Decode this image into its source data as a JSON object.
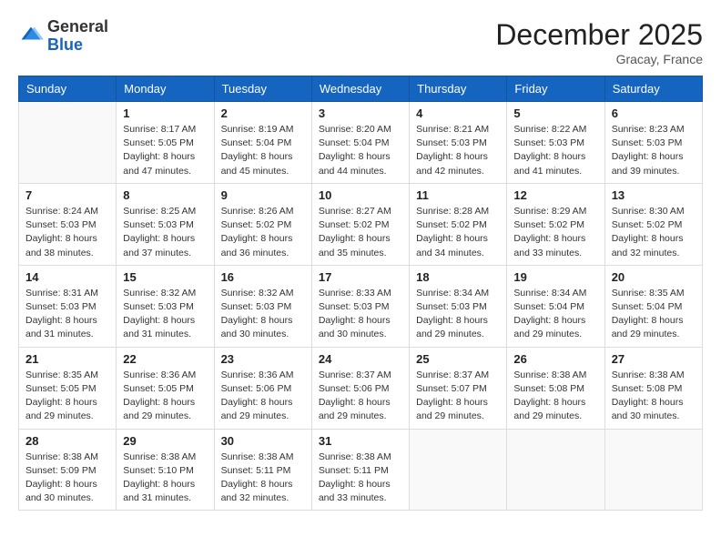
{
  "header": {
    "logo_general": "General",
    "logo_blue": "Blue",
    "month_title": "December 2025",
    "location": "Gracay, France"
  },
  "weekdays": [
    "Sunday",
    "Monday",
    "Tuesday",
    "Wednesday",
    "Thursday",
    "Friday",
    "Saturday"
  ],
  "weeks": [
    [
      {
        "day": "",
        "info": ""
      },
      {
        "day": "1",
        "info": "Sunrise: 8:17 AM\nSunset: 5:05 PM\nDaylight: 8 hours\nand 47 minutes."
      },
      {
        "day": "2",
        "info": "Sunrise: 8:19 AM\nSunset: 5:04 PM\nDaylight: 8 hours\nand 45 minutes."
      },
      {
        "day": "3",
        "info": "Sunrise: 8:20 AM\nSunset: 5:04 PM\nDaylight: 8 hours\nand 44 minutes."
      },
      {
        "day": "4",
        "info": "Sunrise: 8:21 AM\nSunset: 5:03 PM\nDaylight: 8 hours\nand 42 minutes."
      },
      {
        "day": "5",
        "info": "Sunrise: 8:22 AM\nSunset: 5:03 PM\nDaylight: 8 hours\nand 41 minutes."
      },
      {
        "day": "6",
        "info": "Sunrise: 8:23 AM\nSunset: 5:03 PM\nDaylight: 8 hours\nand 39 minutes."
      }
    ],
    [
      {
        "day": "7",
        "info": "Sunrise: 8:24 AM\nSunset: 5:03 PM\nDaylight: 8 hours\nand 38 minutes."
      },
      {
        "day": "8",
        "info": "Sunrise: 8:25 AM\nSunset: 5:03 PM\nDaylight: 8 hours\nand 37 minutes."
      },
      {
        "day": "9",
        "info": "Sunrise: 8:26 AM\nSunset: 5:02 PM\nDaylight: 8 hours\nand 36 minutes."
      },
      {
        "day": "10",
        "info": "Sunrise: 8:27 AM\nSunset: 5:02 PM\nDaylight: 8 hours\nand 35 minutes."
      },
      {
        "day": "11",
        "info": "Sunrise: 8:28 AM\nSunset: 5:02 PM\nDaylight: 8 hours\nand 34 minutes."
      },
      {
        "day": "12",
        "info": "Sunrise: 8:29 AM\nSunset: 5:02 PM\nDaylight: 8 hours\nand 33 minutes."
      },
      {
        "day": "13",
        "info": "Sunrise: 8:30 AM\nSunset: 5:02 PM\nDaylight: 8 hours\nand 32 minutes."
      }
    ],
    [
      {
        "day": "14",
        "info": "Sunrise: 8:31 AM\nSunset: 5:03 PM\nDaylight: 8 hours\nand 31 minutes."
      },
      {
        "day": "15",
        "info": "Sunrise: 8:32 AM\nSunset: 5:03 PM\nDaylight: 8 hours\nand 31 minutes."
      },
      {
        "day": "16",
        "info": "Sunrise: 8:32 AM\nSunset: 5:03 PM\nDaylight: 8 hours\nand 30 minutes."
      },
      {
        "day": "17",
        "info": "Sunrise: 8:33 AM\nSunset: 5:03 PM\nDaylight: 8 hours\nand 30 minutes."
      },
      {
        "day": "18",
        "info": "Sunrise: 8:34 AM\nSunset: 5:03 PM\nDaylight: 8 hours\nand 29 minutes."
      },
      {
        "day": "19",
        "info": "Sunrise: 8:34 AM\nSunset: 5:04 PM\nDaylight: 8 hours\nand 29 minutes."
      },
      {
        "day": "20",
        "info": "Sunrise: 8:35 AM\nSunset: 5:04 PM\nDaylight: 8 hours\nand 29 minutes."
      }
    ],
    [
      {
        "day": "21",
        "info": "Sunrise: 8:35 AM\nSunset: 5:05 PM\nDaylight: 8 hours\nand 29 minutes."
      },
      {
        "day": "22",
        "info": "Sunrise: 8:36 AM\nSunset: 5:05 PM\nDaylight: 8 hours\nand 29 minutes."
      },
      {
        "day": "23",
        "info": "Sunrise: 8:36 AM\nSunset: 5:06 PM\nDaylight: 8 hours\nand 29 minutes."
      },
      {
        "day": "24",
        "info": "Sunrise: 8:37 AM\nSunset: 5:06 PM\nDaylight: 8 hours\nand 29 minutes."
      },
      {
        "day": "25",
        "info": "Sunrise: 8:37 AM\nSunset: 5:07 PM\nDaylight: 8 hours\nand 29 minutes."
      },
      {
        "day": "26",
        "info": "Sunrise: 8:38 AM\nSunset: 5:08 PM\nDaylight: 8 hours\nand 29 minutes."
      },
      {
        "day": "27",
        "info": "Sunrise: 8:38 AM\nSunset: 5:08 PM\nDaylight: 8 hours\nand 30 minutes."
      }
    ],
    [
      {
        "day": "28",
        "info": "Sunrise: 8:38 AM\nSunset: 5:09 PM\nDaylight: 8 hours\nand 30 minutes."
      },
      {
        "day": "29",
        "info": "Sunrise: 8:38 AM\nSunset: 5:10 PM\nDaylight: 8 hours\nand 31 minutes."
      },
      {
        "day": "30",
        "info": "Sunrise: 8:38 AM\nSunset: 5:11 PM\nDaylight: 8 hours\nand 32 minutes."
      },
      {
        "day": "31",
        "info": "Sunrise: 8:38 AM\nSunset: 5:11 PM\nDaylight: 8 hours\nand 33 minutes."
      },
      {
        "day": "",
        "info": ""
      },
      {
        "day": "",
        "info": ""
      },
      {
        "day": "",
        "info": ""
      }
    ]
  ]
}
